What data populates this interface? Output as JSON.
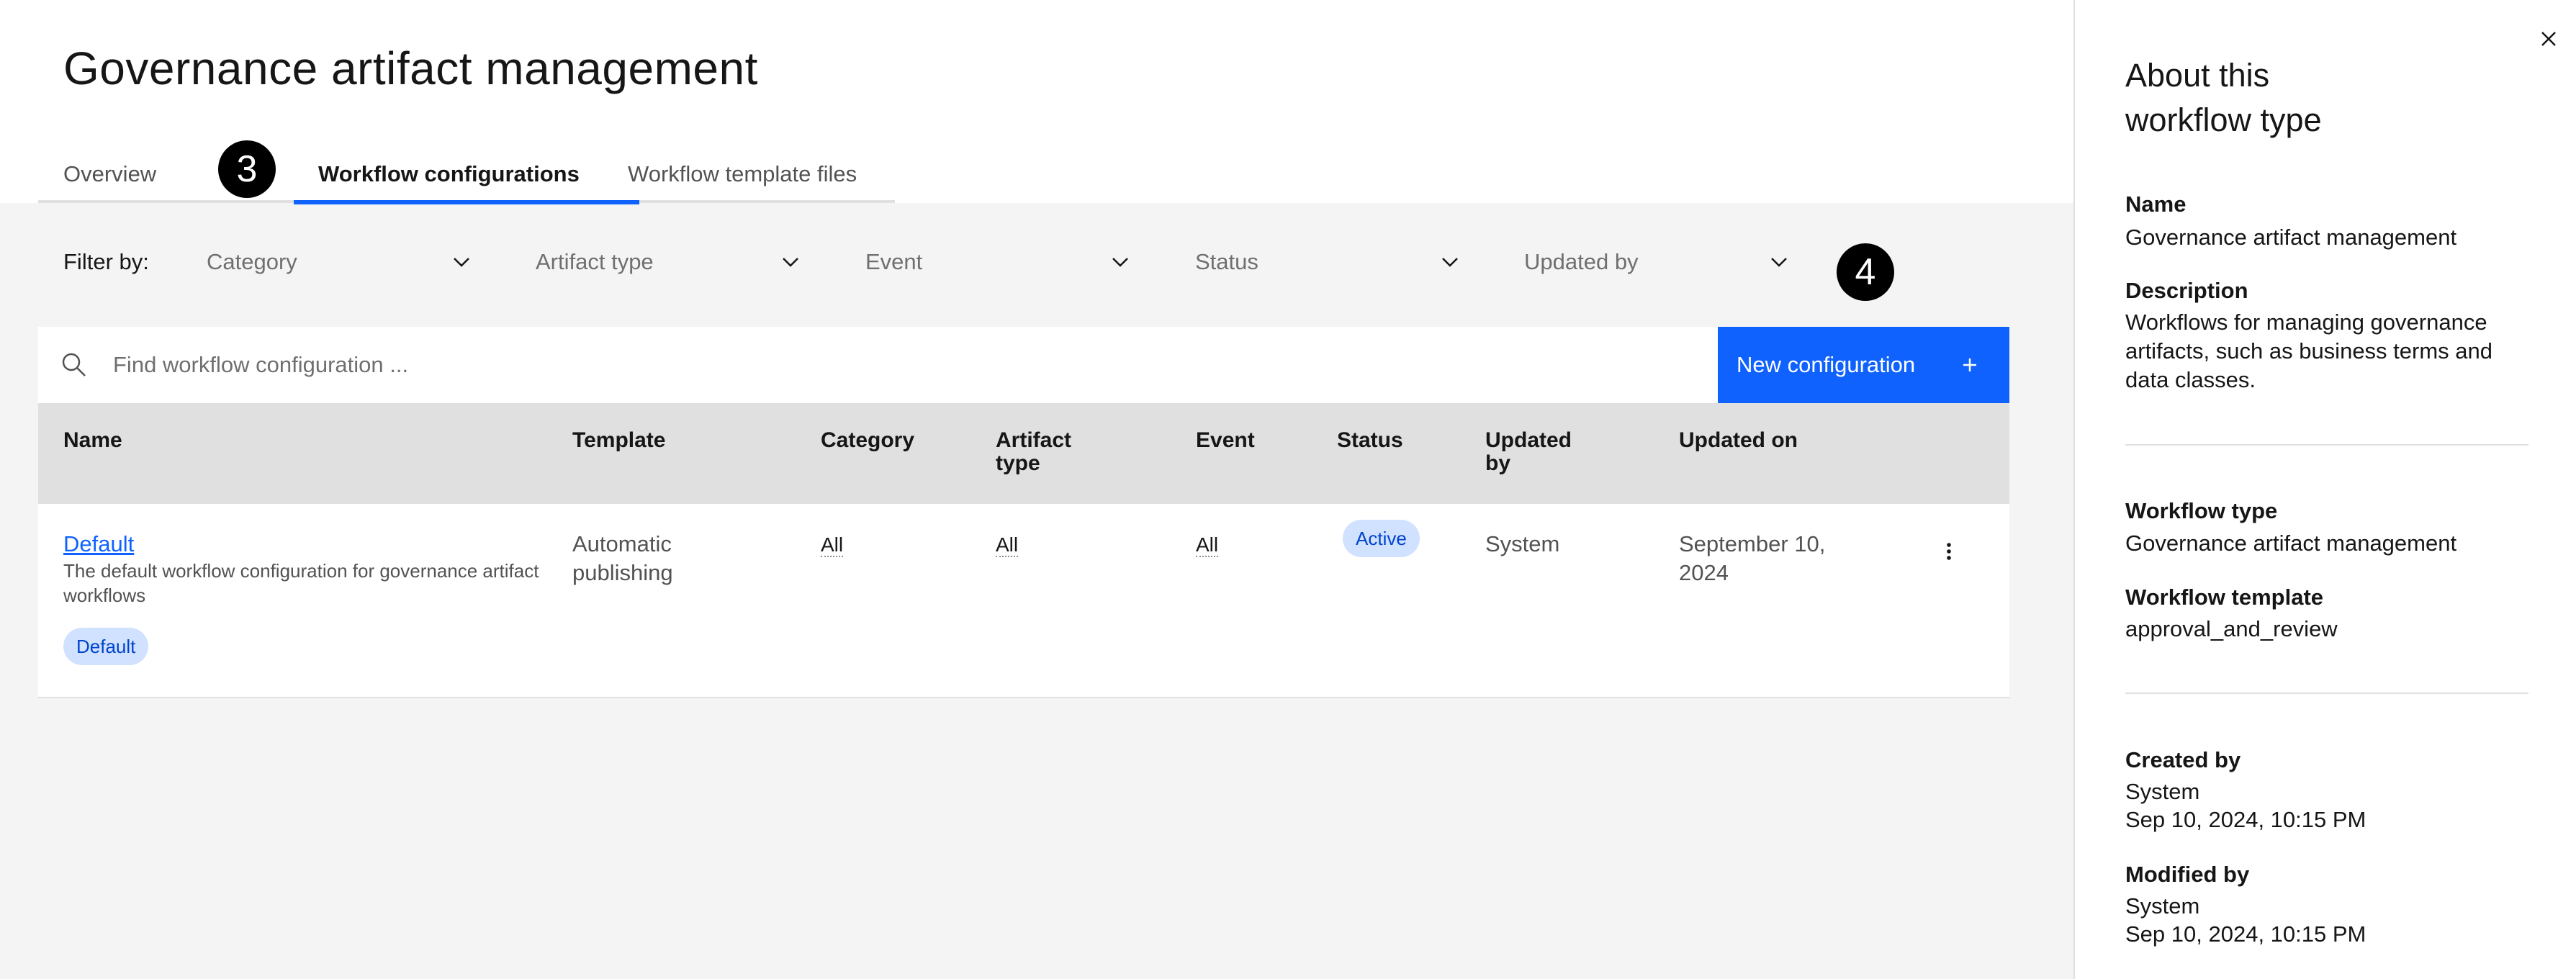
{
  "page": {
    "title": "Governance artifact management"
  },
  "tabs": [
    {
      "label": "Overview",
      "active": false
    },
    {
      "label": "Workflow configurations",
      "active": true
    },
    {
      "label": "Workflow template files",
      "active": false
    }
  ],
  "callouts": [
    "3",
    "4"
  ],
  "filters": {
    "label": "Filter by:",
    "dropdowns": [
      "Category",
      "Artifact type",
      "Event",
      "Status",
      "Updated by"
    ]
  },
  "search": {
    "placeholder": "Find workflow configuration ...",
    "value": ""
  },
  "new_button": {
    "label": "New configuration"
  },
  "table": {
    "columns": [
      "Name",
      "Template",
      "Category",
      "Artifact\ntype",
      "Event",
      "Status",
      "Updated\nby",
      "Updated on"
    ],
    "rows": [
      {
        "name": "Default",
        "description": "The default workflow configuration for governance artifact workflows",
        "tag": "Default",
        "template": "Automatic publishing",
        "category": "All",
        "artifact_type": "All",
        "event": "All",
        "status": "Active",
        "updated_by": "System",
        "updated_on": "September 10, 2024"
      }
    ]
  },
  "side_panel": {
    "title": "About this workflow type",
    "name_label": "Name",
    "name_value": "Governance artifact management",
    "description_label": "Description",
    "description_value": "Workflows for managing governance artifacts, such as business terms and data classes.",
    "workflow_type_label": "Workflow type",
    "workflow_type_value": "Governance artifact management",
    "workflow_template_label": "Workflow template",
    "workflow_template_value": "approval_and_review",
    "created_by_label": "Created by",
    "created_by_user": "System",
    "created_by_date": "Sep 10, 2024, 10:15 PM",
    "modified_by_label": "Modified by",
    "modified_by_user": "System",
    "modified_by_date": "Sep 10, 2024, 10:15 PM"
  },
  "icons": {
    "search": "search-icon",
    "chevron": "chevron-down-icon",
    "add": "add-icon",
    "overflow": "overflow-menu-icon",
    "close": "close-icon"
  },
  "colors": {
    "accent": "#0f62fe",
    "tag_bg": "#d0e2ff",
    "tag_fg": "#0043ce",
    "surface": "#f4f4f4"
  }
}
